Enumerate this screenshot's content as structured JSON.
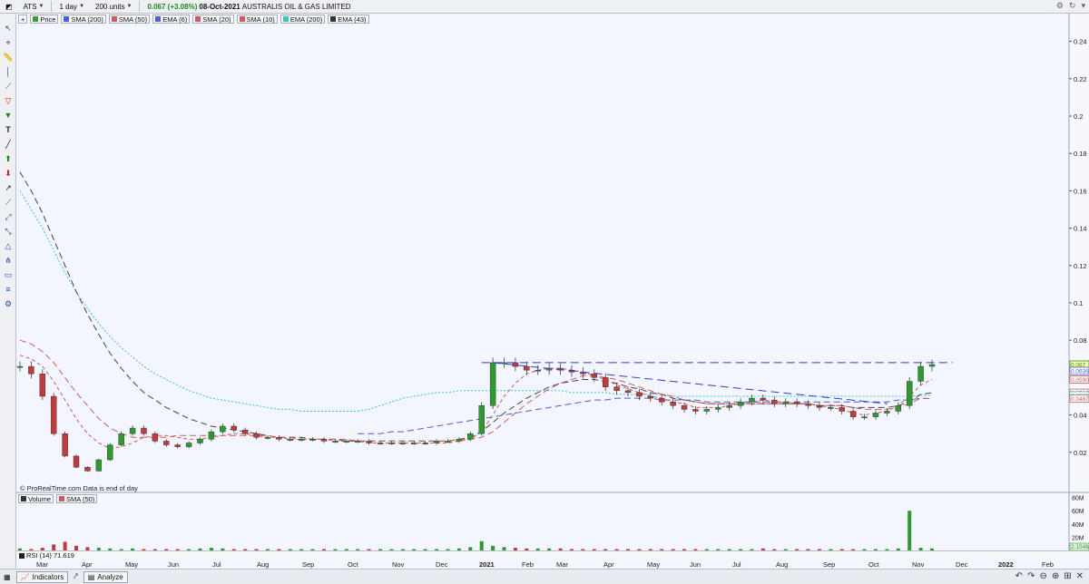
{
  "toolbar_top": {
    "symbol": "ATS",
    "timeframe": "1 day",
    "units": "200 units",
    "price_change": "0.067 (+3.08%)",
    "date": "08-Oct-2021",
    "company": "AUSTRALIS OIL & GAS LIMITED"
  },
  "legend": [
    {
      "label": "Price",
      "color": "#3a9a3a"
    },
    {
      "label": "SMA (200)",
      "color": "#4a5fd8"
    },
    {
      "label": "SMA (50)",
      "color": "#d25a5a"
    },
    {
      "label": "EMA (6)",
      "color": "#4a5fd8"
    },
    {
      "label": "SMA (20)",
      "color": "#d25a5a"
    },
    {
      "label": "SMA (10)",
      "color": "#d25a5a"
    },
    {
      "label": "EMA (200)",
      "color": "#38c9c0"
    },
    {
      "label": "EMA (43)",
      "color": "#333333"
    }
  ],
  "copyright": "© ProRealTime.com  Data is end of day",
  "volume_legend": [
    {
      "label": "Volume",
      "color": "#333333"
    },
    {
      "label": "SMA (50)",
      "color": "#d25a5a"
    }
  ],
  "rsi_label": "RSI (14)  71.619",
  "bottom": {
    "indicators_label": "Indicators",
    "analyze_label": "Analyze"
  },
  "chart_data": {
    "type": "candlestick",
    "y_ticks": [
      "0.24",
      "0.22",
      "0.2",
      "0.18",
      "0.16",
      "0.14",
      "0.12",
      "0.1",
      "0.08",
      "0.06",
      "0.04",
      "0.02"
    ],
    "ylim": [
      0,
      0.25
    ],
    "x_labels": [
      "Mar",
      "Apr",
      "May",
      "Jun",
      "Jul",
      "Aug",
      "Sep",
      "Oct",
      "Nov",
      "Dec",
      "2021",
      "Feb",
      "Mar",
      "Apr",
      "May",
      "Jun",
      "Jul",
      "Aug",
      "Sep",
      "Oct",
      "Nov",
      "Dec",
      "2022",
      "Feb"
    ],
    "price_labels": [
      {
        "value": "0.067",
        "color": "#2c9a2c"
      },
      {
        "value": "0.0636",
        "color": "#4a5fd8"
      },
      {
        "value": "0.0590",
        "color": "#d25a5a"
      },
      {
        "value": "0.0519",
        "color": "#d25a5a"
      },
      {
        "value": "0.0505",
        "color": "#38c9c0"
      },
      {
        "value": "0.0487",
        "color": "#d25a5a"
      }
    ],
    "price_series": [
      0.066,
      0.062,
      0.05,
      0.03,
      0.018,
      0.012,
      0.01,
      0.016,
      0.024,
      0.03,
      0.033,
      0.03,
      0.026,
      0.024,
      0.023,
      0.025,
      0.027,
      0.031,
      0.034,
      0.032,
      0.03,
      0.028,
      0.028,
      0.027,
      0.027,
      0.027,
      0.027,
      0.026,
      0.026,
      0.026,
      0.026,
      0.025,
      0.025,
      0.025,
      0.025,
      0.025,
      0.025,
      0.026,
      0.026,
      0.027,
      0.03,
      0.045,
      0.068,
      0.068,
      0.066,
      0.064,
      0.064,
      0.065,
      0.064,
      0.063,
      0.062,
      0.06,
      0.055,
      0.053,
      0.052,
      0.05,
      0.049,
      0.047,
      0.045,
      0.043,
      0.042,
      0.043,
      0.044,
      0.045,
      0.047,
      0.049,
      0.048,
      0.046,
      0.047,
      0.046,
      0.045,
      0.044,
      0.044,
      0.042,
      0.039,
      0.039,
      0.041,
      0.042,
      0.045,
      0.058,
      0.066,
      0.067
    ],
    "sma200": [
      null,
      null,
      null,
      null,
      null,
      null,
      null,
      null,
      null,
      null,
      null,
      null,
      null,
      null,
      null,
      null,
      null,
      null,
      null,
      null,
      null,
      null,
      null,
      null,
      null,
      null,
      null,
      null,
      null,
      null,
      0.03,
      0.03,
      0.03,
      0.031,
      0.031,
      0.032,
      0.033,
      0.034,
      0.035,
      0.036,
      0.037,
      0.038,
      0.039,
      0.04,
      0.041,
      0.042,
      0.043,
      0.044,
      0.045,
      0.046,
      0.047,
      0.048,
      0.048,
      0.049,
      0.049,
      0.049,
      0.049,
      0.048,
      0.048,
      0.048,
      0.048,
      0.047,
      0.047,
      0.047,
      0.047,
      0.047,
      0.047,
      0.047,
      0.047,
      0.047,
      0.047,
      0.047,
      0.047,
      0.047,
      0.047,
      0.047,
      0.047,
      0.047,
      0.048,
      0.048,
      0.049,
      0.0487
    ],
    "ema200": [
      0.16,
      0.15,
      0.14,
      0.128,
      0.116,
      0.106,
      0.097,
      0.089,
      0.082,
      0.076,
      0.071,
      0.066,
      0.062,
      0.059,
      0.056,
      0.053,
      0.051,
      0.049,
      0.048,
      0.047,
      0.046,
      0.045,
      0.044,
      0.043,
      0.043,
      0.042,
      0.042,
      0.042,
      0.042,
      0.042,
      0.042,
      0.043,
      0.045,
      0.047,
      0.049,
      0.05,
      0.051,
      0.052,
      0.052,
      0.053,
      0.053,
      0.053,
      0.053,
      0.053,
      0.053,
      0.053,
      0.053,
      0.053,
      0.053,
      0.052,
      0.052,
      0.052,
      0.052,
      0.051,
      0.051,
      0.051,
      0.051,
      0.051,
      0.05,
      0.05,
      0.05,
      0.05,
      0.05,
      0.05,
      0.05,
      0.05,
      0.05,
      0.05,
      0.05,
      0.05,
      0.05,
      0.05,
      0.05,
      0.05,
      0.05,
      0.05,
      0.05,
      0.05,
      0.05,
      0.05,
      0.0505,
      0.0505
    ],
    "ema43": [
      0.17,
      0.16,
      0.148,
      0.134,
      0.12,
      0.106,
      0.094,
      0.083,
      0.073,
      0.065,
      0.058,
      0.052,
      0.048,
      0.044,
      0.041,
      0.038,
      0.036,
      0.034,
      0.033,
      0.032,
      0.031,
      0.03,
      0.029,
      0.028,
      0.028,
      0.028,
      0.027,
      0.027,
      0.027,
      0.026,
      0.026,
      0.026,
      0.026,
      0.026,
      0.026,
      0.026,
      0.026,
      0.026,
      0.026,
      0.027,
      0.028,
      0.031,
      0.036,
      0.041,
      0.045,
      0.049,
      0.052,
      0.055,
      0.057,
      0.058,
      0.059,
      0.059,
      0.058,
      0.057,
      0.055,
      0.054,
      0.052,
      0.051,
      0.049,
      0.048,
      0.047,
      0.046,
      0.046,
      0.046,
      0.046,
      0.046,
      0.046,
      0.046,
      0.046,
      0.046,
      0.046,
      0.045,
      0.045,
      0.045,
      0.044,
      0.044,
      0.044,
      0.044,
      0.045,
      0.047,
      0.051,
      0.0519
    ],
    "sma50": [
      0.08,
      0.078,
      0.074,
      0.068,
      0.06,
      0.052,
      0.045,
      0.038,
      0.033,
      0.03,
      0.028,
      0.028,
      0.028,
      0.028,
      0.029,
      0.029,
      0.029,
      0.029,
      0.029,
      0.029,
      0.029,
      0.029,
      0.029,
      0.028,
      0.028,
      0.027,
      0.027,
      0.027,
      0.027,
      0.027,
      0.026,
      0.026,
      0.026,
      0.026,
      0.026,
      0.026,
      0.026,
      0.026,
      0.026,
      0.027,
      0.027,
      0.028,
      0.031,
      0.036,
      0.041,
      0.046,
      0.05,
      0.054,
      0.057,
      0.059,
      0.061,
      0.061,
      0.06,
      0.059,
      0.057,
      0.055,
      0.053,
      0.051,
      0.05,
      0.048,
      0.047,
      0.046,
      0.046,
      0.046,
      0.046,
      0.046,
      0.046,
      0.046,
      0.046,
      0.046,
      0.046,
      0.045,
      0.045,
      0.045,
      0.044,
      0.043,
      0.043,
      0.043,
      0.044,
      0.046,
      0.049,
      0.0487
    ],
    "sma20": [
      0.072,
      0.07,
      0.066,
      0.058,
      0.048,
      0.038,
      0.03,
      0.025,
      0.022,
      0.023,
      0.025,
      0.028,
      0.029,
      0.029,
      0.028,
      0.027,
      0.027,
      0.028,
      0.029,
      0.03,
      0.03,
      0.029,
      0.028,
      0.028,
      0.027,
      0.027,
      0.027,
      0.027,
      0.026,
      0.026,
      0.026,
      0.025,
      0.025,
      0.025,
      0.025,
      0.025,
      0.025,
      0.025,
      0.025,
      0.026,
      0.027,
      0.031,
      0.04,
      0.05,
      0.057,
      0.062,
      0.064,
      0.065,
      0.065,
      0.064,
      0.063,
      0.061,
      0.059,
      0.056,
      0.054,
      0.052,
      0.05,
      0.049,
      0.047,
      0.046,
      0.044,
      0.044,
      0.044,
      0.045,
      0.046,
      0.047,
      0.048,
      0.047,
      0.047,
      0.046,
      0.046,
      0.045,
      0.044,
      0.043,
      0.041,
      0.04,
      0.041,
      0.042,
      0.045,
      0.05,
      0.056,
      0.059
    ],
    "volume": [
      3,
      2,
      4,
      9,
      13,
      7,
      5,
      4,
      3,
      2,
      3,
      2,
      2,
      2,
      2,
      2,
      3,
      4,
      3,
      2,
      2,
      2,
      2,
      2,
      2,
      2,
      2,
      2,
      2,
      2,
      2,
      2,
      2,
      2,
      2,
      2,
      2,
      2,
      2,
      3,
      5,
      14,
      7,
      5,
      4,
      3,
      3,
      3,
      3,
      2,
      2,
      2,
      2,
      2,
      2,
      2,
      2,
      2,
      2,
      2,
      2,
      2,
      2,
      2,
      2,
      2,
      3,
      2,
      2,
      2,
      2,
      2,
      2,
      2,
      2,
      2,
      2,
      2,
      3,
      60,
      4,
      3
    ],
    "volume_ticks": [
      "80M",
      "60M",
      "40M",
      "20M"
    ],
    "volume_label": "2.154M",
    "resistance": 0.068,
    "trendline": [
      0.068,
      0.046
    ]
  }
}
